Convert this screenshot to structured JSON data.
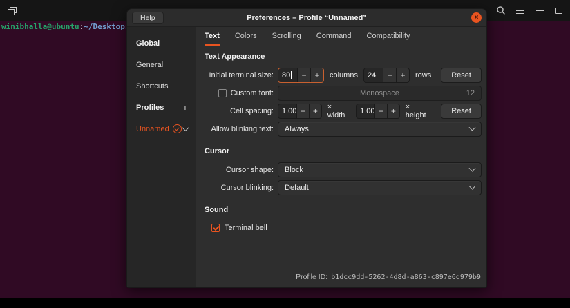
{
  "colors": {
    "accent": "#e95420",
    "terminal_background": "#300a24",
    "prompt_user_green": "#26a269",
    "prompt_path_blue": "#729fcf"
  },
  "terminal": {
    "user": "winibhalla@ubuntu",
    "separator": ":",
    "path": "~/Desktop",
    "symbol": "$"
  },
  "dialog": {
    "help": "Help",
    "title": "Preferences – Profile “Unnamed”",
    "minimize": "–",
    "close": "×",
    "sidebar": {
      "global": "Global",
      "general": "General",
      "shortcuts": "Shortcuts",
      "profiles": "Profiles",
      "add": "+",
      "profile_name": "Unnamed"
    },
    "tabs": [
      {
        "label": "Text"
      },
      {
        "label": "Colors"
      },
      {
        "label": "Scrolling"
      },
      {
        "label": "Command"
      },
      {
        "label": "Compatibility"
      }
    ],
    "form": {
      "text_appearance_title": "Text Appearance",
      "initial_size_label": "Initial terminal size:",
      "columns_value": "80",
      "columns_unit": "columns",
      "rows_value": "24",
      "rows_unit": "rows",
      "reset_size": "Reset",
      "custom_font_label": "Custom font:",
      "font_name": "Monospace",
      "font_size": "12",
      "cell_spacing_label": "Cell spacing:",
      "width_value": "1.00",
      "width_unit": "× width",
      "height_value": "1.00",
      "height_unit": "× height",
      "reset_spacing": "Reset",
      "blinking_label": "Allow blinking text:",
      "blinking_value": "Always",
      "cursor_title": "Cursor",
      "cursor_shape_label": "Cursor shape:",
      "cursor_shape_value": "Block",
      "cursor_blinking_label": "Cursor blinking:",
      "cursor_blinking_value": "Default",
      "sound_title": "Sound",
      "bell_label": "Terminal bell",
      "profile_id_label": "Profile ID:",
      "profile_id_value": "b1dcc9dd-5262-4d8d-a863-c897e6d979b9"
    },
    "controls": {
      "minus": "−",
      "plus": "+"
    }
  }
}
